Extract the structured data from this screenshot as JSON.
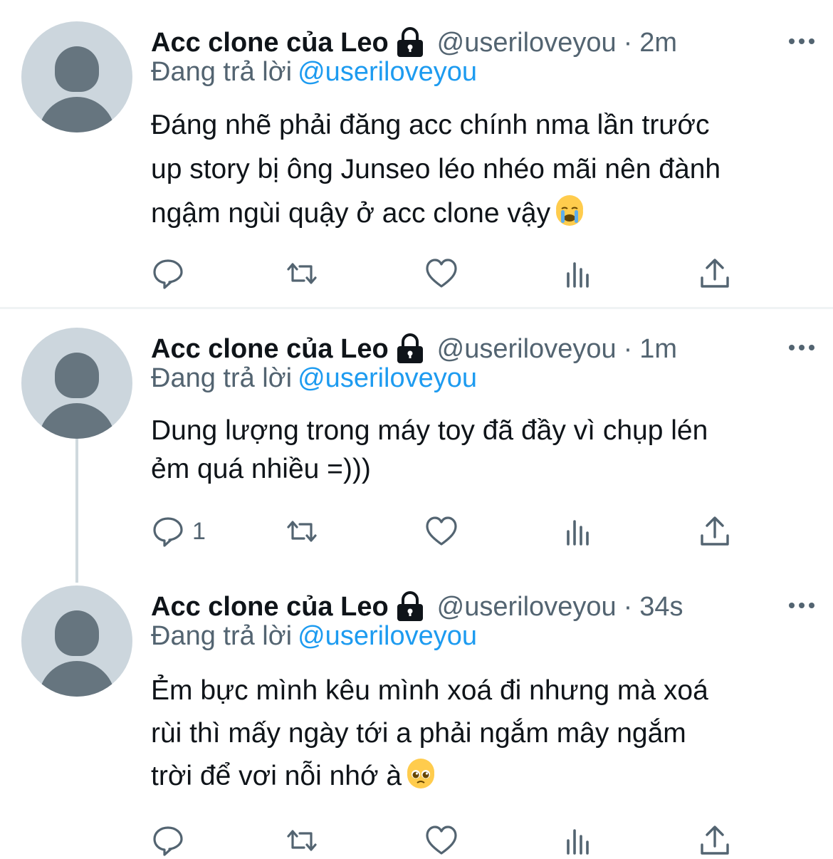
{
  "tweets": [
    {
      "name": "Acc clone của Leo",
      "handle": "@useriloveyou",
      "separator": "·",
      "time": "2m",
      "replying_label": "Đang trả lời",
      "replying_to": "@useriloveyou",
      "text": "Đáng nhẽ phải đăng acc chính nma lần trước\nup story bị ông Junseo léo nhéo mãi nên đành\nngậm ngùi quậy ở acc clone vậy",
      "emoji": "crying-face",
      "reply_count": ""
    },
    {
      "name": "Acc clone của Leo",
      "handle": "@useriloveyou",
      "separator": "·",
      "time": "1m",
      "replying_label": "Đang trả lời",
      "replying_to": "@useriloveyou",
      "text": "Dung lượng trong máy toy đã đầy vì chụp lén\nẻm quá nhiều =)))",
      "emoji": "",
      "reply_count": "1"
    },
    {
      "name": "Acc clone của Leo",
      "handle": "@useriloveyou",
      "separator": "·",
      "time": "34s",
      "replying_label": "Đang trả lời",
      "replying_to": "@useriloveyou",
      "text": "Ẻm bực mình kêu mình xoá đi nhưng mà xoá\nrùi thì mấy ngày tới a phải ngắm mây ngắm\ntrời để vơi nỗi nhớ à",
      "emoji": "pleading-face",
      "reply_count": ""
    }
  ],
  "icons": {
    "reply": "reply-icon",
    "retweet": "retweet-icon",
    "like": "like-icon",
    "views": "views-icon",
    "share": "share-icon",
    "more": "more-icon",
    "lock": "lock-icon"
  },
  "colors": {
    "primary_text": "#0f1419",
    "secondary_text": "#536471",
    "link": "#1d9bf0",
    "avatar_bg": "#ccd6dd",
    "avatar_fg": "#66757f"
  }
}
